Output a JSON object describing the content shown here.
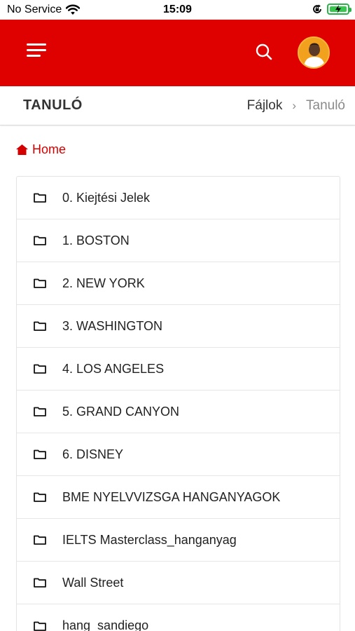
{
  "status_bar": {
    "carrier": "No Service",
    "time": "15:09",
    "icons": [
      "wifi-icon",
      "orientation-lock-icon",
      "battery-charging-icon"
    ]
  },
  "app_bar": {
    "background": "#df0000",
    "icons": [
      "menu-icon",
      "search-icon",
      "avatar"
    ]
  },
  "header": {
    "title": "TANULÓ",
    "breadcrumb": {
      "parent": "Fájlok",
      "separator": "›",
      "current": "Tanuló"
    }
  },
  "home": {
    "label": "Home",
    "icon": "home-icon",
    "color": "#d40000"
  },
  "folders": [
    {
      "name": "0. Kiejtési Jelek"
    },
    {
      "name": "1. BOSTON"
    },
    {
      "name": "2. NEW YORK"
    },
    {
      "name": "3. WASHINGTON"
    },
    {
      "name": "4. LOS ANGELES"
    },
    {
      "name": "5. GRAND CANYON"
    },
    {
      "name": "6. DISNEY"
    },
    {
      "name": "BME NYELVVIZSGA HANGANYAGOK"
    },
    {
      "name": "IELTS Masterclass_hanganyag"
    },
    {
      "name": "Wall Street"
    },
    {
      "name": "hang_sandiego"
    }
  ]
}
